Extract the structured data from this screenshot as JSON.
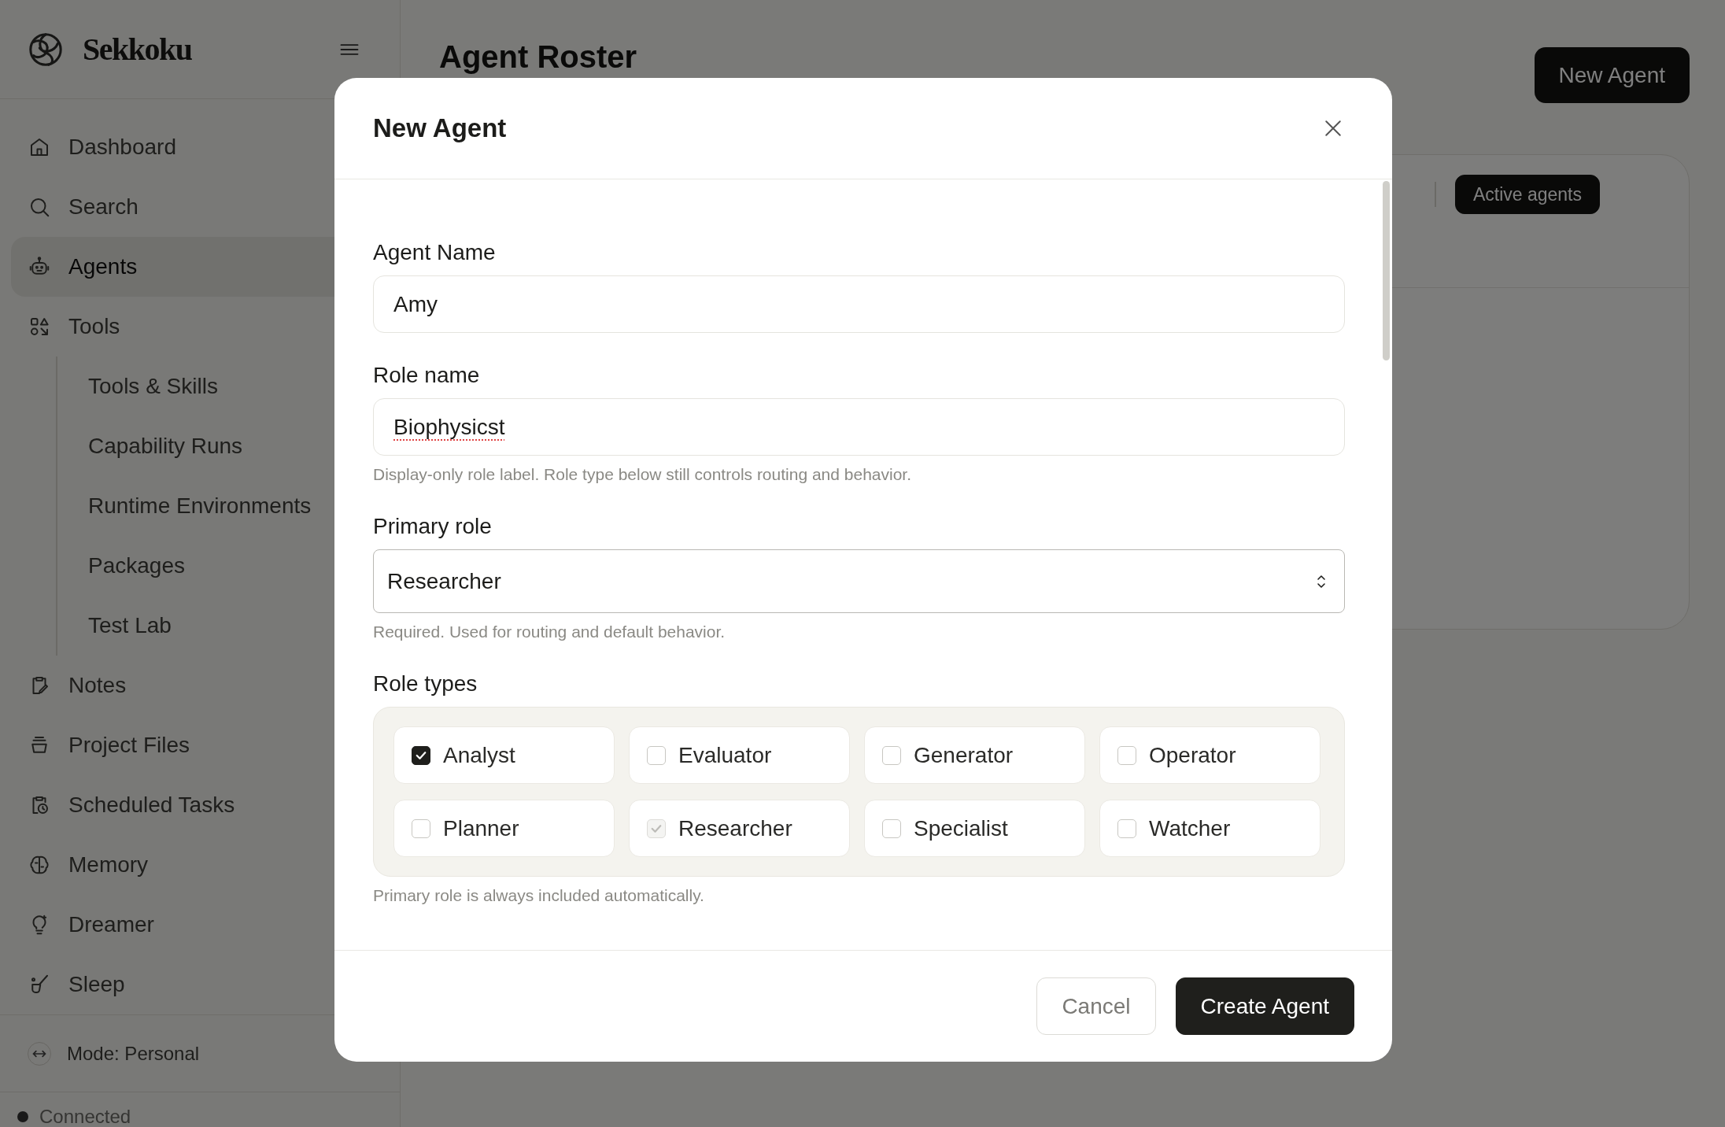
{
  "sidebar": {
    "brand": "Sekkoku",
    "items": [
      {
        "label": "Dashboard",
        "selected": false
      },
      {
        "label": "Search",
        "selected": false
      },
      {
        "label": "Agents",
        "selected": true
      },
      {
        "label": "Tools",
        "selected": false,
        "children": [
          {
            "label": "Tools & Skills",
            "selected": false
          },
          {
            "label": "Capability Runs",
            "selected": false
          },
          {
            "label": "Runtime Environments",
            "selected": false
          },
          {
            "label": "Packages",
            "selected": false
          },
          {
            "label": "Test Lab",
            "selected": false
          }
        ]
      },
      {
        "label": "Notes",
        "selected": false
      },
      {
        "label": "Project Files",
        "selected": false
      },
      {
        "label": "Scheduled Tasks",
        "selected": false
      },
      {
        "label": "Memory",
        "selected": false
      },
      {
        "label": "Dreamer",
        "selected": false
      },
      {
        "label": "Sleep",
        "selected": false
      }
    ],
    "mode": "Mode: Personal",
    "status": "Connected"
  },
  "page": {
    "title": "Agent Roster",
    "new_button": "New Agent",
    "filter": {
      "label": "Active agents",
      "selected": true
    }
  },
  "dialog": {
    "title": "New Agent",
    "fields": [
      {
        "kind": "text",
        "label": "Agent Name",
        "value": "Amy",
        "spelling_error": false
      },
      {
        "kind": "text",
        "label": "Role name",
        "value": "Biophysicst",
        "spelling_error": true,
        "help": "Display-only role label. Role type below still controls routing and behavior."
      },
      {
        "kind": "select",
        "label": "Primary role",
        "value": "Researcher",
        "help": "Required. Used for routing and default behavior."
      },
      {
        "kind": "checkgroup",
        "label": "Role types",
        "help": "Primary role is always included automatically.",
        "options": [
          {
            "label": "Analyst",
            "checked": true,
            "disabled": false
          },
          {
            "label": "Evaluator",
            "checked": false,
            "disabled": false
          },
          {
            "label": "Generator",
            "checked": false,
            "disabled": false
          },
          {
            "label": "Operator",
            "checked": false,
            "disabled": false
          },
          {
            "label": "Planner",
            "checked": false,
            "disabled": false
          },
          {
            "label": "Researcher",
            "checked": true,
            "disabled": true
          },
          {
            "label": "Specialist",
            "checked": false,
            "disabled": false
          },
          {
            "label": "Watcher",
            "checked": false,
            "disabled": false
          }
        ]
      }
    ],
    "buttons": [
      {
        "label": "Cancel",
        "kind": "secondary"
      },
      {
        "label": "Create Agent",
        "kind": "primary"
      }
    ]
  }
}
